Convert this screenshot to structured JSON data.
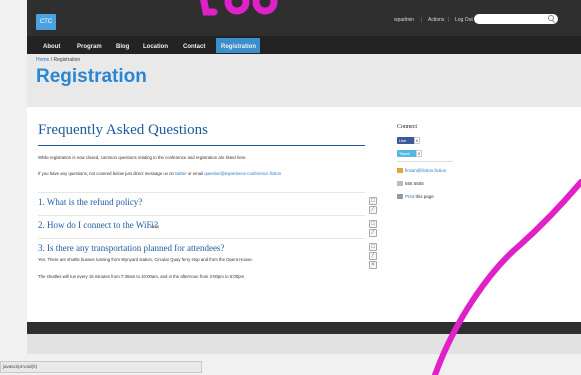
{
  "header": {
    "logo": "CTC",
    "admin": {
      "user": "wpadmin",
      "actions": "Actions",
      "logout": "Log Out"
    }
  },
  "nav": [
    "About",
    "Program",
    "Blog",
    "Location",
    "Contact",
    "Registration"
  ],
  "breadcrumb": {
    "home": "Home",
    "current": "/ Registration"
  },
  "page": {
    "title": "Registration"
  },
  "faq": {
    "title": "Frequently Asked Questions",
    "intro1": "While registration is now closed, common questions relating to the conference and registration are listed here.",
    "intro2_prefix": "If you have any questions, not covered below just direct message us on ",
    "intro2_twitter": "twitter",
    "intro2_mid": " or email ",
    "intro2_email": "question@experience-conference.fiction",
    "q1": "1. What is the refund policy?",
    "q2": "2. How do I connect to the WiFi?",
    "q2_view": "view",
    "q3": "3. Is there any transportation planned for attendees?",
    "q3_answer": "Yes. There are shuttle busses running from Wynyard station, Circular Quay ferry stop and from the Opera House.",
    "q3_answer2": "The shuttles will run every 15 minutes from 7:30am to 10:00am, and in the afternoon from 3:00pm to 6:00pm"
  },
  "sidebar": {
    "title": "Connect",
    "like": "Like",
    "like_count": "0",
    "tweet": "Tweet",
    "tweet_count": "0",
    "email": "fiction@fiction.fiction",
    "phone": "555 5555",
    "print_label": "Print",
    "print_rest": " this page"
  },
  "status": "javascript:void(0)",
  "colors": {
    "accent": "#3b8fcc",
    "title": "#2a86d3",
    "magenta": "#e020c8"
  }
}
